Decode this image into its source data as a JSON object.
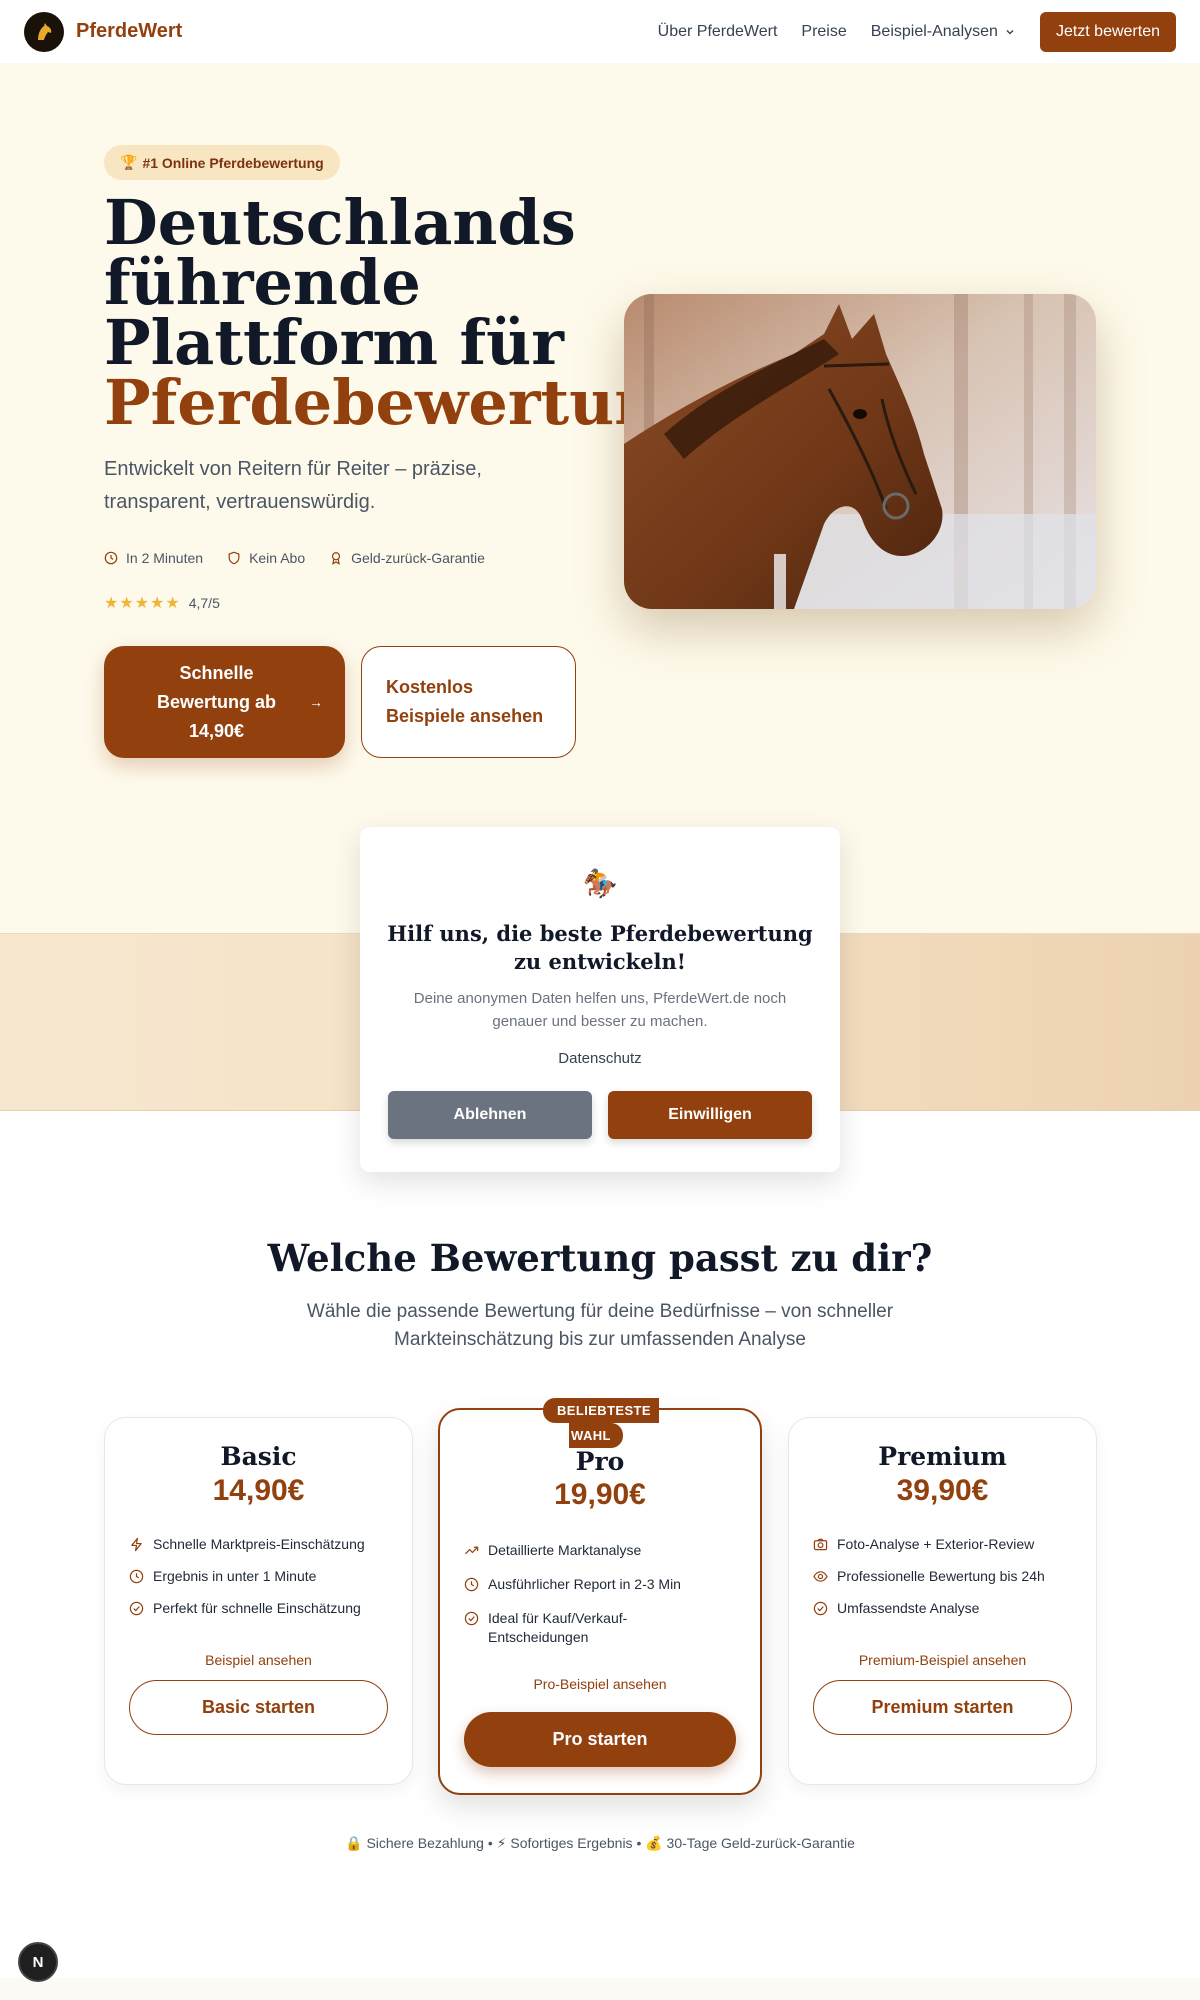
{
  "nav": {
    "brand": "PferdeWert",
    "links": [
      "Über PferdeWert",
      "Preise",
      "Beispiel-Analysen"
    ],
    "cta": "Jetzt bewerten"
  },
  "hero": {
    "badge_icon": "🏆",
    "badge": "#1 Online Pferdebewertung",
    "title_line1": "Deutschlands",
    "title_line2": "führende",
    "title_line3": "Plattform für",
    "title_accent": "Pferdebewertung",
    "subtitle": "Entwickelt von Reitern für Reiter – präzise, transparent, vertrauenswürdig.",
    "features": [
      "In 2 Minuten",
      "Kein Abo",
      "Geld-zurück-Garantie"
    ],
    "stars": "★★★★★",
    "rating": "4,7/5",
    "cta_primary": "Schnelle Bewertung ab 14,90€",
    "cta_primary_arrow": "→",
    "cta_secondary": "Kostenlos Beispiele ansehen"
  },
  "consent": {
    "icon": "🏇",
    "title": "Hilf uns, die beste Pferdebewertung zu entwickeln!",
    "text": "Deine anonymen Daten helfen uns, PferdeWert.de noch genauer und besser zu machen.",
    "link": "Datenschutz",
    "decline": "Ablehnen",
    "accept": "Einwilligen"
  },
  "pricing": {
    "title": "Welche Bewertung passt zu dir?",
    "subtitle": "Wähle die passende Bewertung für deine Bedürfnisse – von schneller Markteinschätzung bis zur umfassenden Analyse",
    "plans": [
      {
        "name": "Basic",
        "price": "14,90€",
        "features": [
          "Schnelle Marktpreis-Einschätzung",
          "Ergebnis in unter 1 Minute",
          "Perfekt für schnelle Einschätzung"
        ],
        "link": "Beispiel ansehen",
        "button": "Basic starten"
      },
      {
        "name": "Pro",
        "badge_line1": "BELIEBTESTE",
        "badge_line2": "WAHL",
        "price": "19,90€",
        "features": [
          "Detaillierte Marktanalyse",
          "Ausführlicher Report in 2-3 Min",
          "Ideal für Kauf/Verkauf-Entscheidungen"
        ],
        "link": "Pro-Beispiel ansehen",
        "button": "Pro starten"
      },
      {
        "name": "Premium",
        "price": "39,90€",
        "features": [
          "Foto-Analyse + Exterior-Review",
          "Professionelle Bewertung bis 24h",
          "Umfassendste Analyse"
        ],
        "link": "Premium-Beispiel ansehen",
        "button": "Premium starten"
      }
    ],
    "trust": "🔒 Sichere Bezahlung • ⚡ Sofortiges Ergebnis • 💰 30-Tage Geld-zurück-Garantie"
  },
  "dev_badge": "N",
  "colors": {
    "brand": "#92400e",
    "hero_bg": "#fefaeb",
    "decline": "#6b7280"
  }
}
